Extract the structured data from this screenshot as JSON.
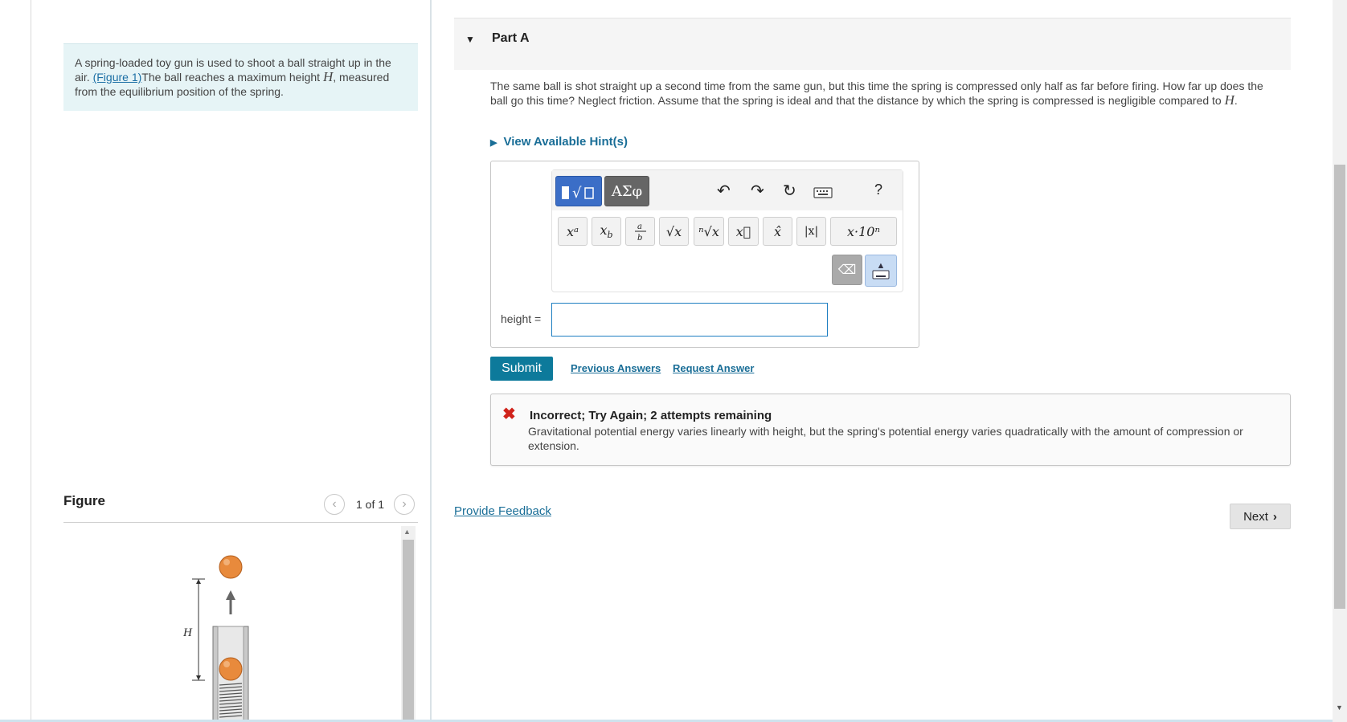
{
  "problem": {
    "text_before_link": "A spring-loaded toy gun is used to shoot a ball straight up in the air. ",
    "figure_link": "(Figure 1)",
    "text_after_link": "The ball reaches a maximum height ",
    "height_symbol": "H",
    "text_end": ", measured from the equilibrium position of the spring."
  },
  "figure": {
    "title": "Figure",
    "counter": "1 of 1",
    "prev_icon": "chevron-left-icon",
    "next_icon": "chevron-right-icon",
    "height_label": "H"
  },
  "part": {
    "title": "Part A",
    "question_text": "The same ball is shot straight up a second time from the same gun, but this time the spring is compressed only half as far before firing. How far up does the ball go this time? Neglect friction. Assume that the spring is ideal and that the distance by which the spring is compressed is negligible compared to ",
    "question_symbol": "H",
    "question_end": ".",
    "hints_label": "View Available Hint(s)"
  },
  "toolbar": {
    "greek_label": "ΑΣφ",
    "help_label": "?",
    "buttons": [
      "xᵃ",
      "xb",
      "a/b",
      "√x",
      "ⁿ√x",
      "x⃗",
      "x̂",
      "|x|",
      "x·10ⁿ"
    ]
  },
  "answer": {
    "label": "height =",
    "value": ""
  },
  "actions": {
    "submit_label": "Submit",
    "previous_answers_label": "Previous Answers",
    "request_answer_label": "Request Answer"
  },
  "feedback": {
    "title": "Incorrect; Try Again; 2 attempts remaining",
    "text": "Gravitational potential energy varies linearly with height, but the spring's potential energy varies quadratically with the amount of compression or extension.",
    "status_color": "#d0231b"
  },
  "footer": {
    "provide_feedback_label": "Provide Feedback",
    "next_label": "Next"
  },
  "colors": {
    "accent": "#0d7a9b",
    "link": "#1a6e97",
    "problem_bg": "#e6f4f6",
    "ball": "#e88a3c"
  }
}
